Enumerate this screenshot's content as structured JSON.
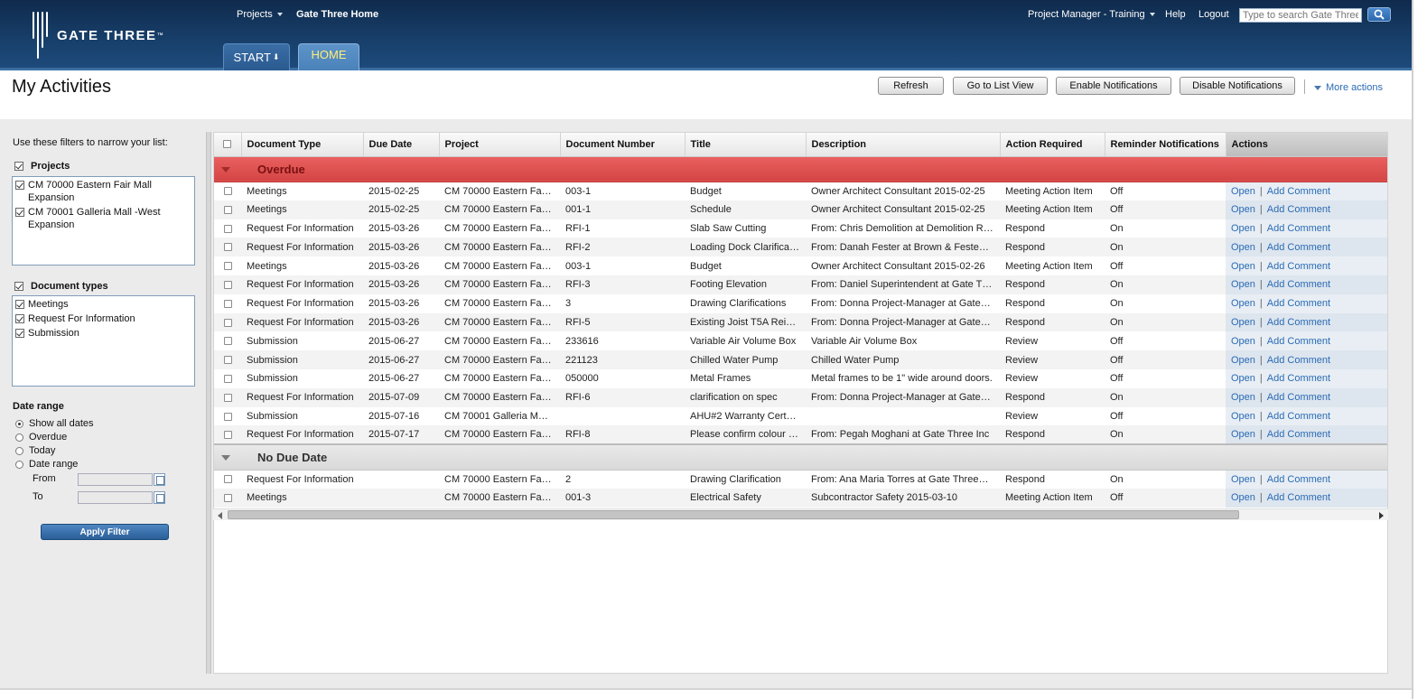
{
  "header": {
    "logo_text": "GATE THREE",
    "nav_projects": "Projects",
    "nav_home": "Gate Three Home",
    "user_menu": "Project Manager - Training",
    "help": "Help",
    "logout": "Logout",
    "search_placeholder": "Type to search Gate Three"
  },
  "tabs": {
    "start": "START",
    "home": "HOME"
  },
  "page": {
    "title": "My Activities",
    "buttons": {
      "refresh": "Refresh",
      "list_view": "Go to List View",
      "enable": "Enable Notifications",
      "disable": "Disable Notifications"
    },
    "more_actions": "More actions"
  },
  "filters": {
    "intro": "Use these filters to narrow your list:",
    "projects_label": "Projects",
    "projects": [
      "CM 70000 Eastern Fair Mall Expansion",
      "CM 70001 Galleria Mall -West Expansion"
    ],
    "doc_types_label": "Document types",
    "doc_types": [
      "Meetings",
      "Request For Information",
      "Submission"
    ],
    "date_range_label": "Date range",
    "date_options": [
      "Show all dates",
      "Overdue",
      "Today",
      "Date range"
    ],
    "selected_date_option": "Show all dates",
    "from_label": "From",
    "to_label": "To",
    "apply": "Apply Filter"
  },
  "grid": {
    "columns": [
      "Document Type",
      "Due Date",
      "Project",
      "Document Number",
      "Title",
      "Description",
      "Action Required",
      "Reminder Notifications",
      "Actions"
    ],
    "open_label": "Open",
    "comment_label": "Add Comment",
    "groups": [
      {
        "name": "Overdue",
        "rows": [
          [
            "Meetings",
            "2015-02-25",
            "CM 70000 Eastern Fa…",
            "003-1",
            "Budget",
            "Owner Architect Consultant 2015-02-25",
            "Meeting Action Item",
            "Off"
          ],
          [
            "Meetings",
            "2015-02-25",
            "CM 70000 Eastern Fa…",
            "001-1",
            "Schedule",
            "Owner Architect Consultant 2015-02-25",
            "Meeting Action Item",
            "Off"
          ],
          [
            "Request For Information",
            "2015-03-26",
            "CM 70000 Eastern Fa…",
            "RFI-1",
            "Slab Saw Cutting",
            "From: Chris Demolition at Demolition R…",
            "Respond",
            "On"
          ],
          [
            "Request For Information",
            "2015-03-26",
            "CM 70000 Eastern Fa…",
            "RFI-2",
            "Loading Dock Clarifica…",
            "From: Danah Fester at Brown & Feste…",
            "Respond",
            "On"
          ],
          [
            "Meetings",
            "2015-03-26",
            "CM 70000 Eastern Fa…",
            "003-1",
            "Budget",
            "Owner Architect Consultant 2015-02-26",
            "Meeting Action Item",
            "Off"
          ],
          [
            "Request For Information",
            "2015-03-26",
            "CM 70000 Eastern Fa…",
            "RFI-3",
            "Footing Elevation",
            "From: Daniel Superintendent at Gate T…",
            "Respond",
            "On"
          ],
          [
            "Request For Information",
            "2015-03-26",
            "CM 70000 Eastern Fa…",
            "3",
            "Drawing Clarifications",
            "From: Donna Project-Manager at Gate…",
            "Respond",
            "On"
          ],
          [
            "Request For Information",
            "2015-03-26",
            "CM 70000 Eastern Fa…",
            "RFI-5",
            "Existing Joist T5A Rei…",
            "From: Donna Project-Manager at Gate…",
            "Respond",
            "On"
          ],
          [
            "Submission",
            "2015-06-27",
            "CM 70000 Eastern Fa…",
            "233616",
            "Variable Air Volume Box",
            "Variable Air Volume Box",
            "Review",
            "Off"
          ],
          [
            "Submission",
            "2015-06-27",
            "CM 70000 Eastern Fa…",
            "221123",
            "Chilled Water Pump",
            "Chilled Water Pump",
            "Review",
            "Off"
          ],
          [
            "Submission",
            "2015-06-27",
            "CM 70000 Eastern Fa…",
            "050000",
            "Metal Frames",
            "Metal frames to be 1\" wide around doors.",
            "Review",
            "Off"
          ],
          [
            "Request For Information",
            "2015-07-09",
            "CM 70000 Eastern Fa…",
            "RFI-6",
            "clarification on spec",
            "From: Donna Project-Manager at Gate…",
            "Respond",
            "On"
          ],
          [
            "Submission",
            "2015-07-16",
            "CM 70001 Galleria M…",
            "",
            "AHU#2 Warranty Cert…",
            "",
            "Review",
            "Off"
          ],
          [
            "Request For Information",
            "2015-07-17",
            "CM 70000 Eastern Fa…",
            "RFI-8",
            "Please confirm colour …",
            "From: Pegah Moghani at Gate Three Inc",
            "Respond",
            "On"
          ]
        ]
      },
      {
        "name": "No Due Date",
        "rows": [
          [
            "Request For Information",
            "",
            "CM 70000 Eastern Fa…",
            "2",
            "Drawing Clarification",
            "From: Ana Maria Torres at Gate Three…",
            "Respond",
            "On"
          ],
          [
            "Meetings",
            "",
            "CM 70000 Eastern Fa…",
            "001-3",
            "Electrical Safety",
            "Subcontractor Safety 2015-03-10",
            "Meeting Action Item",
            "Off"
          ]
        ]
      }
    ]
  },
  "colors": {
    "header": "#173e68",
    "overdue": "#e05252",
    "link": "#2a6bb5",
    "home_tab_text": "#ffef7a"
  }
}
